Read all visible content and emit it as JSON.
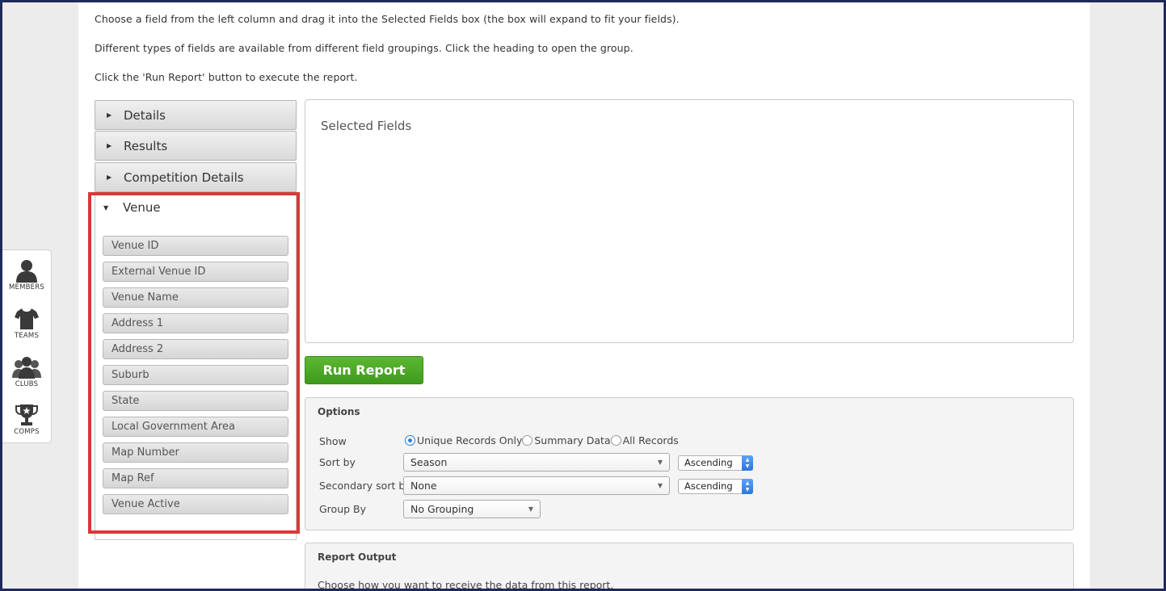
{
  "instructions": {
    "line1": "Choose a field from the left column and drag it into the Selected Fields box (the box will expand to fit your fields).",
    "line2": "Different types of fields are available from different field groupings. Click the heading to open the group.",
    "line3": "Click the 'Run Report' button to execute the report."
  },
  "groups": {
    "details": "Details",
    "results": "Results",
    "competition": "Competition Details",
    "venue": "Venue"
  },
  "venue_fields": [
    "Venue ID",
    "External Venue ID",
    "Venue Name",
    "Address 1",
    "Address 2",
    "Suburb",
    "State",
    "Local Government Area",
    "Map Number",
    "Map Ref",
    "Venue Active"
  ],
  "selected": {
    "title": "Selected Fields"
  },
  "run_button": "Run Report",
  "options": {
    "heading": "Options",
    "show_label": "Show",
    "show_options": [
      "Unique Records Only",
      "Summary Data",
      "All Records"
    ],
    "show_selected": "Unique Records Only",
    "sort_label": "Sort by",
    "sort_value": "Season",
    "sort_order": "Ascending",
    "secondary_label": "Secondary sort by",
    "secondary_value": "None",
    "secondary_order": "Ascending",
    "group_label": "Group By",
    "group_value": "No Grouping"
  },
  "output": {
    "heading": "Report Output",
    "text": "Choose how you want to receive the data from this report."
  },
  "nav": {
    "members": "MEMBERS",
    "teams": "TEAMS",
    "clubs": "CLUBS",
    "comps": "COMPS"
  },
  "colors": {
    "highlight": "#d9383a",
    "run_button": "#4aa824",
    "radio_accent": "#2f7fdc",
    "frame": "#1f2a5a"
  }
}
